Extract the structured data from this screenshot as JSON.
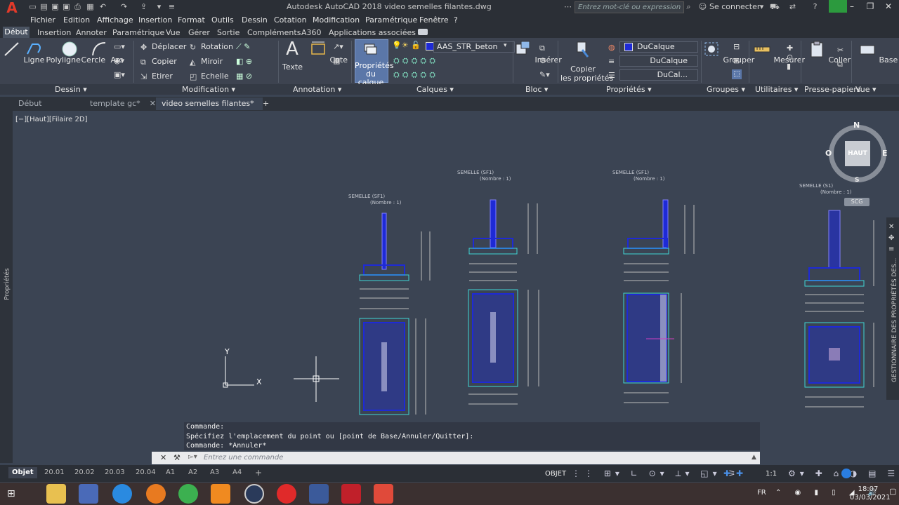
{
  "titlebar": {
    "title": "Autodesk AutoCAD 2018    video semelles filantes.dwg",
    "search_placeholder": "Entrez mot-clé ou expression",
    "signin": "Se connecter",
    "help": "?"
  },
  "menu": [
    "Fichier",
    "Edition",
    "Affichage",
    "Insertion",
    "Format",
    "Outils",
    "Dessin",
    "Cotation",
    "Modification",
    "Paramétrique",
    "Fenêtre",
    "?"
  ],
  "ribbon_tabs": [
    "Début",
    "Insertion",
    "Annoter",
    "Paramétrique",
    "Vue",
    "Gérer",
    "Sortie",
    "Compléments",
    "A360",
    "Applications associées"
  ],
  "ribbon": {
    "dessin": {
      "ligne": "Ligne",
      "polyligne": "Polyligne",
      "cercle": "Cercle",
      "arc": "Arc",
      "panel": "Dessin"
    },
    "modification": {
      "deplacer": "Déplacer",
      "rotation": "Rotation",
      "copier": "Copier",
      "miroir": "Miroir",
      "etirer": "Etirer",
      "echelle": "Echelle",
      "panel": "Modification"
    },
    "annotation": {
      "texte": "Texte",
      "cote": "Cote",
      "panel": "Annotation"
    },
    "calques": {
      "proprietes_l1": "Propriétés",
      "proprietes_l2": "du calque",
      "layer": "AAS_STR_beton",
      "panel": "Calques"
    },
    "bloc": {
      "inserer": "Insérer",
      "panel": "Bloc"
    },
    "proprietes": {
      "copier_l1": "Copier",
      "copier_l2": "les propriétés",
      "color": "DuCalque",
      "linetype": "DuCalque",
      "lineweight": "DuCal...",
      "panel": "Propriétés"
    },
    "groupes": {
      "grouper": "Grouper",
      "panel": "Groupes"
    },
    "utilitaires": {
      "mesurer": "Mesurer",
      "panel": "Utilitaires"
    },
    "presse": {
      "coller": "Coller",
      "panel": "Presse-papiers"
    },
    "vue": {
      "base": "Base",
      "panel": "Vue"
    }
  },
  "doc_tabs": [
    "Début",
    "template gc*",
    "video semelles filantes*"
  ],
  "view_label": "[−][Haut][Filaire 2D]",
  "viewcube": {
    "n": "N",
    "s": "S",
    "e": "E",
    "o": "O",
    "center": "HAUT",
    "scg": "SCG"
  },
  "drawing": {
    "labels": [
      {
        "title": "SEMELLE (SF1)",
        "sub": "(Nombre : 1)"
      },
      {
        "title": "SEMELLE (SF1)",
        "sub": "(Nombre : 1)"
      },
      {
        "title": "SEMELLE (SF1)",
        "sub": "(Nombre : 1)"
      },
      {
        "title": "SEMELLE (S1)",
        "sub": "(Nombre : 1)"
      }
    ]
  },
  "left_palette": "Propriétés",
  "right_palette": "GESTIONNAIRE DES PROPRIÉTÉS DES...",
  "command": {
    "history": [
      "Commande:",
      "Spécifiez l'emplacement du point ou [point de Base/Annuler/Quitter]:",
      "Commande: *Annuler*"
    ],
    "placeholder": "Entrez une commande"
  },
  "layout_tabs": [
    "Objet",
    "20.01",
    "20.02",
    "20.03",
    "20.04",
    "A1",
    "A2",
    "A3",
    "A4",
    "+"
  ],
  "status": {
    "objet": "OBJET",
    "scale": "1:1"
  },
  "taskbar": {
    "lang": "FR",
    "time": "18:07",
    "date": "03/03/2021"
  },
  "colors": {
    "accent": "#5b77a8",
    "drawing_blue": "#1e2ad6",
    "drawing_cyan": "#3fd6d6",
    "canvas": "#3b4453"
  }
}
